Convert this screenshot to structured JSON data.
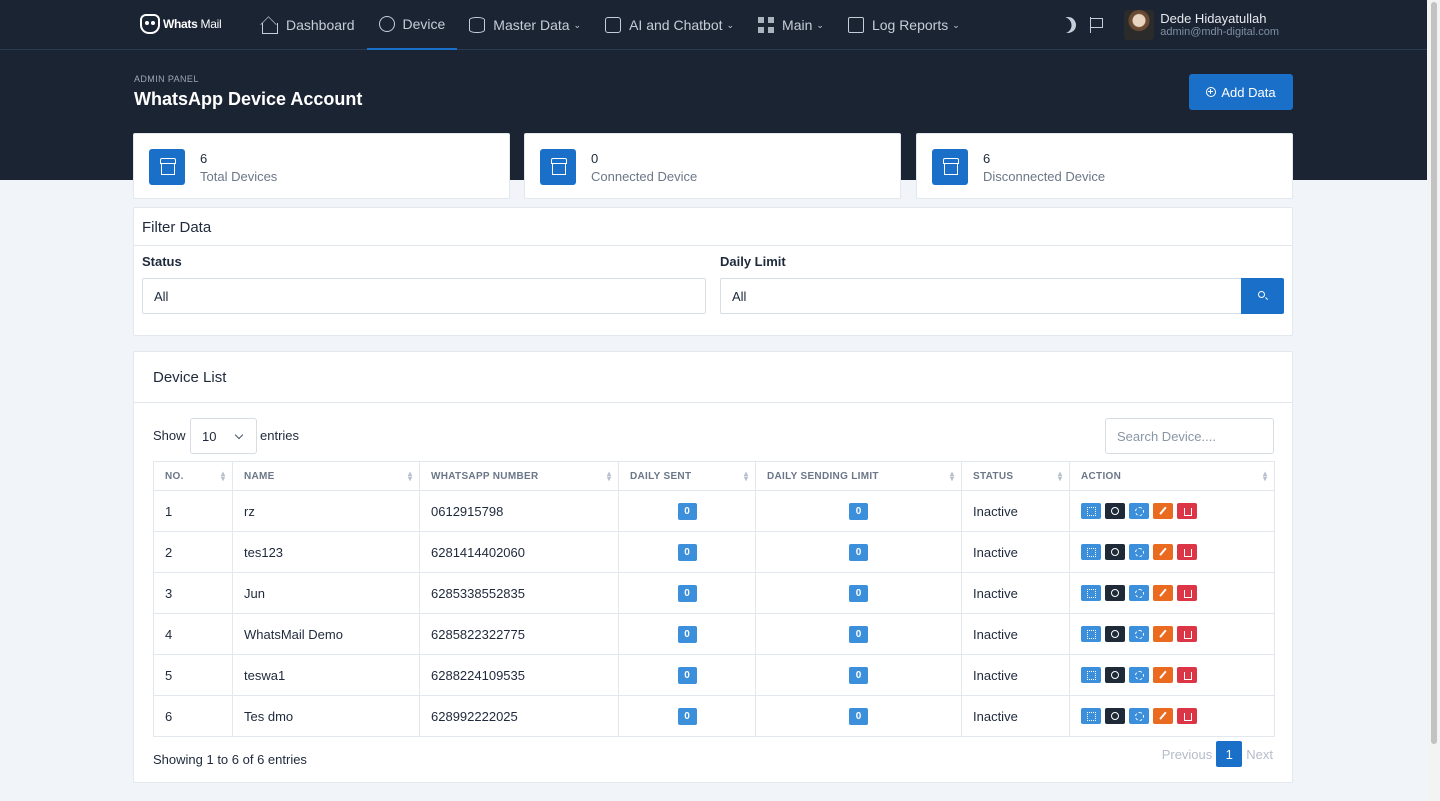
{
  "brand": {
    "logo_bold": "Whats",
    "logo_light": "Mail"
  },
  "nav": {
    "items": [
      {
        "label": "Dashboard",
        "icon": "home-icon"
      },
      {
        "label": "Device",
        "icon": "whatsapp-icon"
      },
      {
        "label": "Master Data",
        "icon": "database-icon"
      },
      {
        "label": "AI and Chatbot",
        "icon": "chatbot-icon"
      },
      {
        "label": "Main",
        "icon": "apps-icon"
      },
      {
        "label": "Log Reports",
        "icon": "report-icon"
      }
    ],
    "active": "Device"
  },
  "user": {
    "name": "Dede Hidayatullah",
    "email": "admin@mdh-digital.com"
  },
  "header": {
    "panel_label": "ADMIN PANEL",
    "title": "WhatsApp Device Account",
    "add_button": "Add Data"
  },
  "stats": [
    {
      "value": "6",
      "label": "Total Devices"
    },
    {
      "value": "0",
      "label": "Connected Device"
    },
    {
      "value": "6",
      "label": "Disconnected Device"
    }
  ],
  "filter": {
    "title": "Filter Data",
    "status_label": "Status",
    "status_value": "All",
    "limit_label": "Daily Limit",
    "limit_value": "All"
  },
  "device_list": {
    "title": "Device List",
    "show_label": "Show",
    "page_length": "10",
    "entries_label": "entries",
    "search_placeholder": "Search Device....",
    "columns": [
      "NO.",
      "NAME",
      "WHATSAPP NUMBER",
      "DAILY SENT",
      "DAILY SENDING LIMIT",
      "STATUS",
      "ACTION"
    ],
    "rows": [
      {
        "no": "1",
        "name": "rz",
        "number": "0612915798",
        "sent": "0",
        "limit": "0",
        "status": "Inactive"
      },
      {
        "no": "2",
        "name": "tes123",
        "number": "6281414402060",
        "sent": "0",
        "limit": "0",
        "status": "Inactive"
      },
      {
        "no": "3",
        "name": "Jun",
        "number": "6285338552835",
        "sent": "0",
        "limit": "0",
        "status": "Inactive"
      },
      {
        "no": "4",
        "name": "WhatsMail Demo",
        "number": "6285822322775",
        "sent": "0",
        "limit": "0",
        "status": "Inactive"
      },
      {
        "no": "5",
        "name": "teswa1",
        "number": "6288224109535",
        "sent": "0",
        "limit": "0",
        "status": "Inactive"
      },
      {
        "no": "6",
        "name": "Tes dmo",
        "number": "628992222025",
        "sent": "0",
        "limit": "0",
        "status": "Inactive"
      }
    ],
    "info": "Showing 1 to 6 of 6 entries",
    "pagination": {
      "previous": "Previous",
      "current": "1",
      "next": "Next"
    }
  },
  "colors": {
    "primary": "#1a6fc9",
    "navbar": "#1b2432",
    "badge": "#3b8fdb",
    "edit": "#ea6a1f",
    "delete": "#dc3545"
  }
}
